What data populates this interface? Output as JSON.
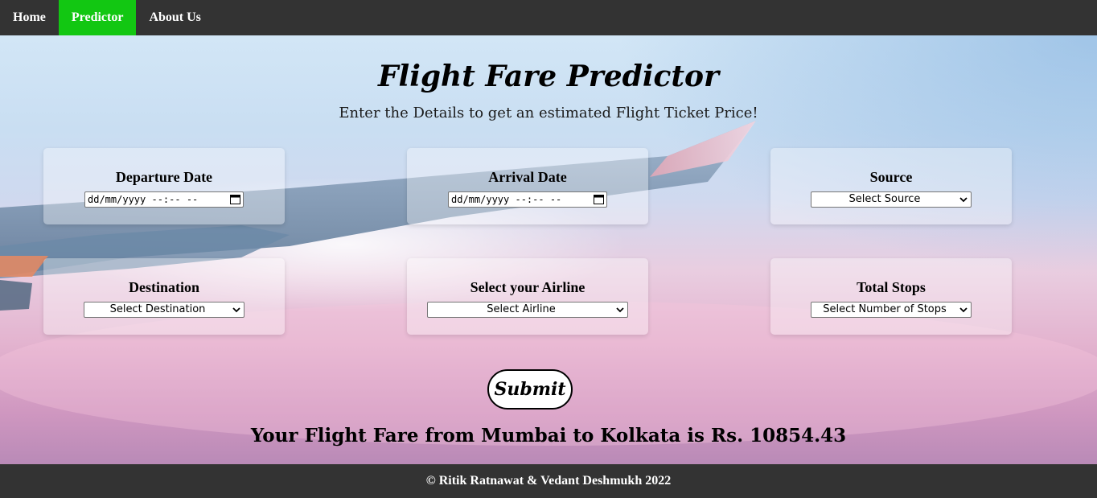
{
  "nav": {
    "items": [
      {
        "label": "Home"
      },
      {
        "label": "Predictor"
      },
      {
        "label": "About Us"
      }
    ],
    "active_index": 1,
    "active_color": "#12c712",
    "bar_color": "#333333"
  },
  "hero": {
    "title": "Flight Fare Predictor",
    "subtitle": "Enter the Details to get an estimated Flight Ticket Price!"
  },
  "form": {
    "departure": {
      "label": "Departure Date",
      "value": "dd/mm/yyyy --:-- --",
      "icon": "calendar-icon"
    },
    "arrival": {
      "label": "Arrival Date",
      "value": "dd/mm/yyyy --:-- --",
      "icon": "calendar-icon"
    },
    "source": {
      "label": "Source",
      "selected": "Select Source"
    },
    "destination": {
      "label": "Destination",
      "selected": "Select Destination"
    },
    "airline": {
      "label": "Select your Airline",
      "selected": "Select Airline"
    },
    "stops": {
      "label": "Total Stops",
      "selected": "Select Number of Stops"
    },
    "submit_label": "Submit"
  },
  "result": {
    "text": "Your Flight Fare from Mumbai to Kolkata is Rs. 10854.43"
  },
  "footer": {
    "text": "© Ritik Ratnawat & Vedant Deshmukh 2022"
  }
}
